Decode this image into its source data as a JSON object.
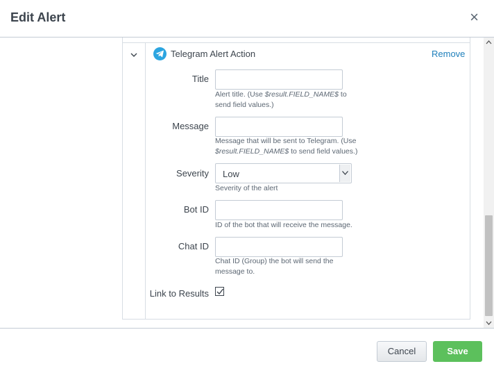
{
  "modal": {
    "title": "Edit Alert",
    "close_symbol": "×"
  },
  "action": {
    "icon": "telegram-icon",
    "icon_color": "#2ca5e0",
    "title": "Telegram Alert Action",
    "remove_label": "Remove"
  },
  "fields": {
    "title": {
      "label": "Title",
      "value": "",
      "help_pre": "Alert title. (Use ",
      "help_var": "$result.FIELD_NAME$",
      "help_post": " to send field values.)"
    },
    "message": {
      "label": "Message",
      "value": "",
      "help_pre": "Message that will be sent to Telegram. (Use ",
      "help_var": "$result.FIELD_NAME$",
      "help_post": " to send field values.)"
    },
    "severity": {
      "label": "Severity",
      "selected": "Low",
      "help": "Severity of the alert"
    },
    "bot_id": {
      "label": "Bot ID",
      "value": "",
      "help": "ID of the bot that will receive the message."
    },
    "chat_id": {
      "label": "Chat ID",
      "value": "",
      "help": "Chat ID (Group) the bot will send the message to."
    },
    "link_to_results": {
      "label": "Link to Results",
      "checked": true
    }
  },
  "footer": {
    "cancel_label": "Cancel",
    "save_label": "Save",
    "save_color": "#5cc05c"
  }
}
